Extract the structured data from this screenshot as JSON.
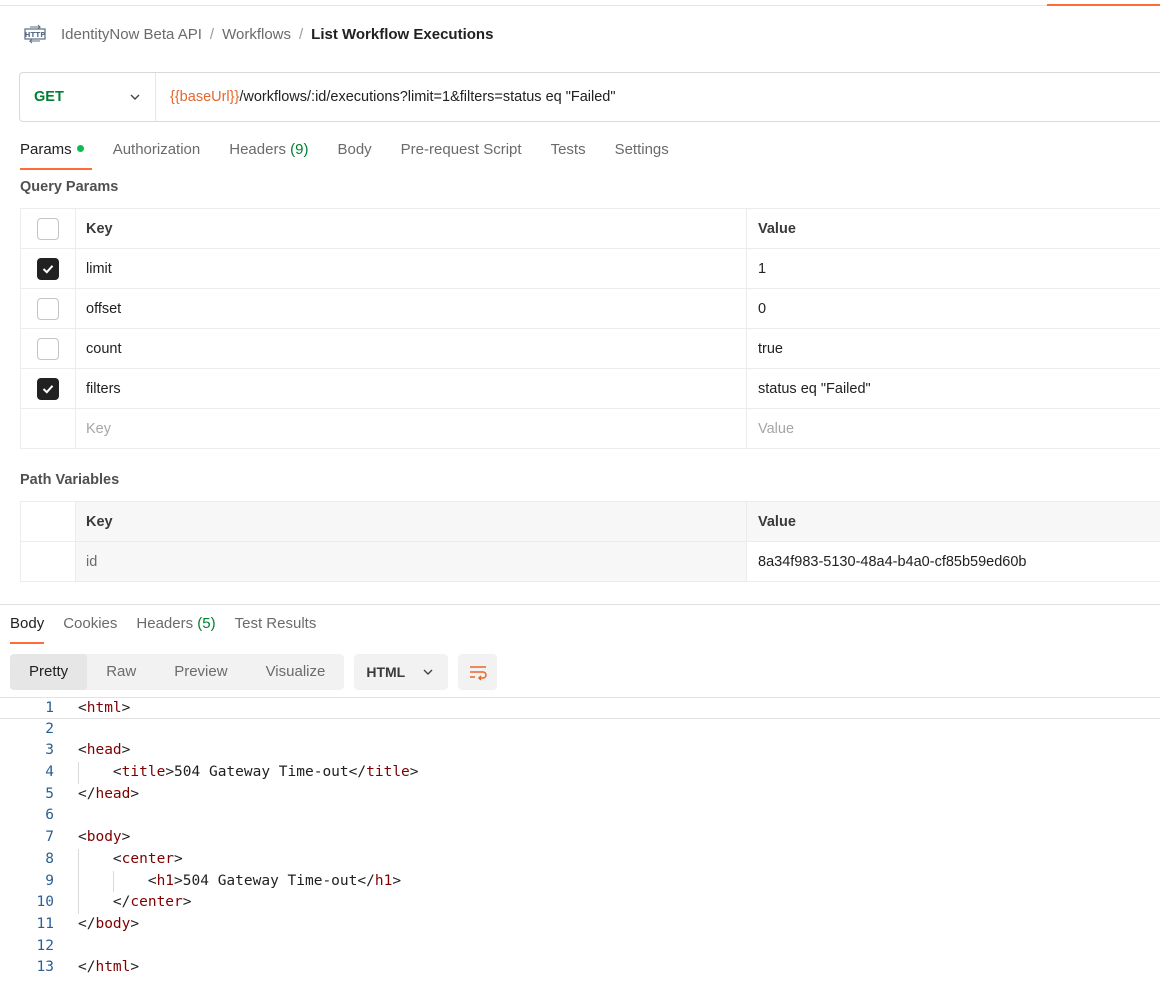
{
  "breadcrumb": {
    "collection": "IdentityNow Beta API",
    "folder": "Workflows",
    "request": "List Workflow Executions",
    "separator": "/",
    "icon": "http-icon"
  },
  "request": {
    "method": "GET",
    "url_variable": "{{baseUrl}}",
    "url_path": "/workflows/:id/executions?limit=1&filters=status eq \"Failed\""
  },
  "tabs": [
    {
      "label": "Params",
      "active": true,
      "dot": true
    },
    {
      "label": "Authorization"
    },
    {
      "label": "Headers",
      "count": "(9)"
    },
    {
      "label": "Body"
    },
    {
      "label": "Pre-request Script"
    },
    {
      "label": "Tests"
    },
    {
      "label": "Settings"
    }
  ],
  "query_params": {
    "title": "Query Params",
    "header": {
      "key": "Key",
      "value": "Value"
    },
    "rows": [
      {
        "key": "limit",
        "value": "1",
        "checked": true
      },
      {
        "key": "offset",
        "value": "0",
        "checked": false
      },
      {
        "key": "count",
        "value": "true",
        "checked": false
      },
      {
        "key": "filters",
        "value": "status eq \"Failed\"",
        "checked": true
      }
    ],
    "placeholder": {
      "key": "Key",
      "value": "Value"
    }
  },
  "path_variables": {
    "title": "Path Variables",
    "header": {
      "key": "Key",
      "value": "Value"
    },
    "rows": [
      {
        "key": "id",
        "value": "8a34f983-5130-48a4-b4a0-cf85b59ed60b"
      }
    ]
  },
  "response": {
    "tabs": [
      {
        "label": "Body",
        "active": true
      },
      {
        "label": "Cookies"
      },
      {
        "label": "Headers",
        "count": "(5)"
      },
      {
        "label": "Test Results"
      }
    ],
    "views": [
      "Pretty",
      "Raw",
      "Preview",
      "Visualize"
    ],
    "active_view": "Pretty",
    "language": "HTML",
    "code_lines": [
      "<html>",
      "",
      "<head>",
      "    <title>504 Gateway Time-out</title>",
      "</head>",
      "",
      "<body>",
      "    <center>",
      "        <h1>504 Gateway Time-out</h1>",
      "    </center>",
      "</body>",
      "",
      "</html>"
    ]
  },
  "colors": {
    "accent": "#ff6c37",
    "method_get": "#007f31",
    "url_variable": "#e8662c",
    "params_dot": "#0cbb52"
  }
}
